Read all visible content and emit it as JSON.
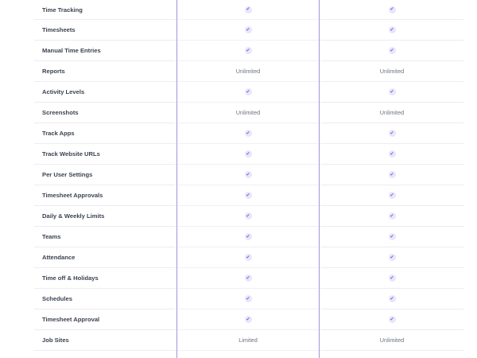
{
  "rows": [
    {
      "feature": "Time Tracking",
      "plan_a": "check",
      "plan_b": "check"
    },
    {
      "feature": "Timesheets",
      "plan_a": "check",
      "plan_b": "check"
    },
    {
      "feature": "Manual Time Entries",
      "plan_a": "check",
      "plan_b": "check"
    },
    {
      "feature": "Reports",
      "plan_a": "Unlimited",
      "plan_b": "Unlimited"
    },
    {
      "feature": "Activity Levels",
      "plan_a": "check",
      "plan_b": "check"
    },
    {
      "feature": "Screenshots",
      "plan_a": "Unlimited",
      "plan_b": "Unlimited"
    },
    {
      "feature": "Track Apps",
      "plan_a": "check",
      "plan_b": "check"
    },
    {
      "feature": "Track Website URLs",
      "plan_a": "check",
      "plan_b": "check"
    },
    {
      "feature": "Per User Settings",
      "plan_a": "check",
      "plan_b": "check"
    },
    {
      "feature": "Timesheet Approvals",
      "plan_a": "check",
      "plan_b": "check"
    },
    {
      "feature": "Daily & Weekly Limits",
      "plan_a": "check",
      "plan_b": "check"
    },
    {
      "feature": "Teams",
      "plan_a": "check",
      "plan_b": "check"
    },
    {
      "feature": "Attendance",
      "plan_a": "check",
      "plan_b": "check"
    },
    {
      "feature": "Time off & Holidays",
      "plan_a": "check",
      "plan_b": "check"
    },
    {
      "feature": "Schedules",
      "plan_a": "check",
      "plan_b": "check"
    },
    {
      "feature": "Timesheet Approval",
      "plan_a": "check",
      "plan_b": "check"
    },
    {
      "feature": "Job Sites",
      "plan_a": "Limited",
      "plan_b": "Unlimited"
    }
  ],
  "colors": {
    "check_bg": "#e8e6fb",
    "check_mark": "#6b63d6",
    "column_border": "#9a97e0"
  },
  "icons": {
    "check": "check-icon"
  }
}
